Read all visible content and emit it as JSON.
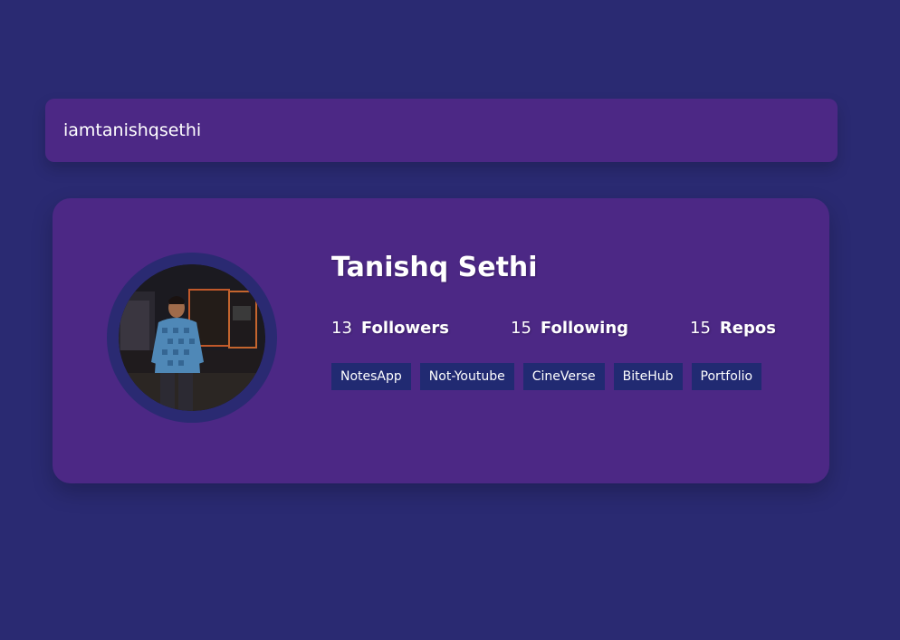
{
  "search": {
    "value": "iamtanishqsethi"
  },
  "profile": {
    "name": "Tanishq Sethi",
    "stats": [
      {
        "number": "13",
        "label": "Followers"
      },
      {
        "number": "15",
        "label": "Following"
      },
      {
        "number": "15",
        "label": "Repos"
      }
    ],
    "repos": [
      "NotesApp",
      "Not-Youtube",
      "CineVerse",
      "BiteHub",
      "Portfolio"
    ]
  },
  "colors": {
    "background": "#2a2a72",
    "card": "#4c2885",
    "repo_badge": "#212a72",
    "text": "#ffffff"
  }
}
